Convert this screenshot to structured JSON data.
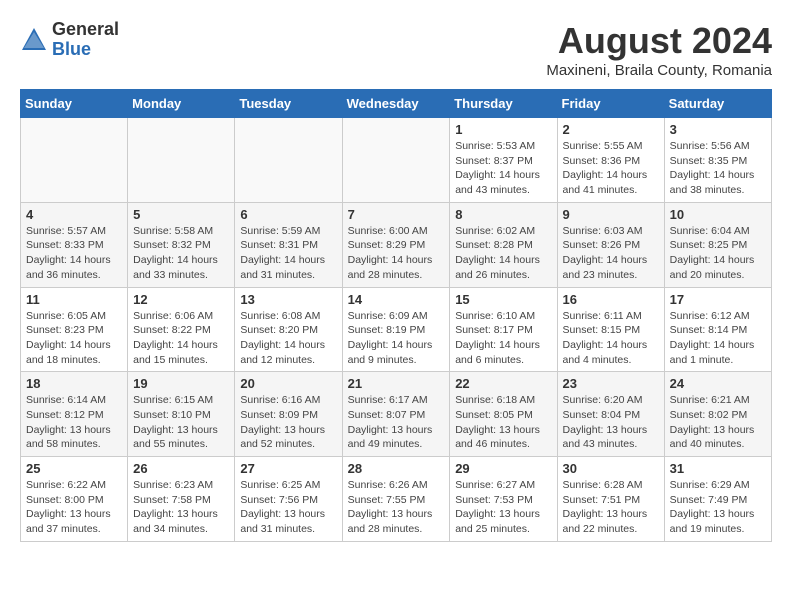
{
  "header": {
    "logo_general": "General",
    "logo_blue": "Blue",
    "month_year": "August 2024",
    "location": "Maxineni, Braila County, Romania"
  },
  "weekdays": [
    "Sunday",
    "Monday",
    "Tuesday",
    "Wednesday",
    "Thursday",
    "Friday",
    "Saturday"
  ],
  "weeks": [
    [
      {
        "day": "",
        "info": ""
      },
      {
        "day": "",
        "info": ""
      },
      {
        "day": "",
        "info": ""
      },
      {
        "day": "",
        "info": ""
      },
      {
        "day": "1",
        "info": "Sunrise: 5:53 AM\nSunset: 8:37 PM\nDaylight: 14 hours and 43 minutes."
      },
      {
        "day": "2",
        "info": "Sunrise: 5:55 AM\nSunset: 8:36 PM\nDaylight: 14 hours and 41 minutes."
      },
      {
        "day": "3",
        "info": "Sunrise: 5:56 AM\nSunset: 8:35 PM\nDaylight: 14 hours and 38 minutes."
      }
    ],
    [
      {
        "day": "4",
        "info": "Sunrise: 5:57 AM\nSunset: 8:33 PM\nDaylight: 14 hours and 36 minutes."
      },
      {
        "day": "5",
        "info": "Sunrise: 5:58 AM\nSunset: 8:32 PM\nDaylight: 14 hours and 33 minutes."
      },
      {
        "day": "6",
        "info": "Sunrise: 5:59 AM\nSunset: 8:31 PM\nDaylight: 14 hours and 31 minutes."
      },
      {
        "day": "7",
        "info": "Sunrise: 6:00 AM\nSunset: 8:29 PM\nDaylight: 14 hours and 28 minutes."
      },
      {
        "day": "8",
        "info": "Sunrise: 6:02 AM\nSunset: 8:28 PM\nDaylight: 14 hours and 26 minutes."
      },
      {
        "day": "9",
        "info": "Sunrise: 6:03 AM\nSunset: 8:26 PM\nDaylight: 14 hours and 23 minutes."
      },
      {
        "day": "10",
        "info": "Sunrise: 6:04 AM\nSunset: 8:25 PM\nDaylight: 14 hours and 20 minutes."
      }
    ],
    [
      {
        "day": "11",
        "info": "Sunrise: 6:05 AM\nSunset: 8:23 PM\nDaylight: 14 hours and 18 minutes."
      },
      {
        "day": "12",
        "info": "Sunrise: 6:06 AM\nSunset: 8:22 PM\nDaylight: 14 hours and 15 minutes."
      },
      {
        "day": "13",
        "info": "Sunrise: 6:08 AM\nSunset: 8:20 PM\nDaylight: 14 hours and 12 minutes."
      },
      {
        "day": "14",
        "info": "Sunrise: 6:09 AM\nSunset: 8:19 PM\nDaylight: 14 hours and 9 minutes."
      },
      {
        "day": "15",
        "info": "Sunrise: 6:10 AM\nSunset: 8:17 PM\nDaylight: 14 hours and 6 minutes."
      },
      {
        "day": "16",
        "info": "Sunrise: 6:11 AM\nSunset: 8:15 PM\nDaylight: 14 hours and 4 minutes."
      },
      {
        "day": "17",
        "info": "Sunrise: 6:12 AM\nSunset: 8:14 PM\nDaylight: 14 hours and 1 minute."
      }
    ],
    [
      {
        "day": "18",
        "info": "Sunrise: 6:14 AM\nSunset: 8:12 PM\nDaylight: 13 hours and 58 minutes."
      },
      {
        "day": "19",
        "info": "Sunrise: 6:15 AM\nSunset: 8:10 PM\nDaylight: 13 hours and 55 minutes."
      },
      {
        "day": "20",
        "info": "Sunrise: 6:16 AM\nSunset: 8:09 PM\nDaylight: 13 hours and 52 minutes."
      },
      {
        "day": "21",
        "info": "Sunrise: 6:17 AM\nSunset: 8:07 PM\nDaylight: 13 hours and 49 minutes."
      },
      {
        "day": "22",
        "info": "Sunrise: 6:18 AM\nSunset: 8:05 PM\nDaylight: 13 hours and 46 minutes."
      },
      {
        "day": "23",
        "info": "Sunrise: 6:20 AM\nSunset: 8:04 PM\nDaylight: 13 hours and 43 minutes."
      },
      {
        "day": "24",
        "info": "Sunrise: 6:21 AM\nSunset: 8:02 PM\nDaylight: 13 hours and 40 minutes."
      }
    ],
    [
      {
        "day": "25",
        "info": "Sunrise: 6:22 AM\nSunset: 8:00 PM\nDaylight: 13 hours and 37 minutes."
      },
      {
        "day": "26",
        "info": "Sunrise: 6:23 AM\nSunset: 7:58 PM\nDaylight: 13 hours and 34 minutes."
      },
      {
        "day": "27",
        "info": "Sunrise: 6:25 AM\nSunset: 7:56 PM\nDaylight: 13 hours and 31 minutes."
      },
      {
        "day": "28",
        "info": "Sunrise: 6:26 AM\nSunset: 7:55 PM\nDaylight: 13 hours and 28 minutes."
      },
      {
        "day": "29",
        "info": "Sunrise: 6:27 AM\nSunset: 7:53 PM\nDaylight: 13 hours and 25 minutes."
      },
      {
        "day": "30",
        "info": "Sunrise: 6:28 AM\nSunset: 7:51 PM\nDaylight: 13 hours and 22 minutes."
      },
      {
        "day": "31",
        "info": "Sunrise: 6:29 AM\nSunset: 7:49 PM\nDaylight: 13 hours and 19 minutes."
      }
    ]
  ]
}
